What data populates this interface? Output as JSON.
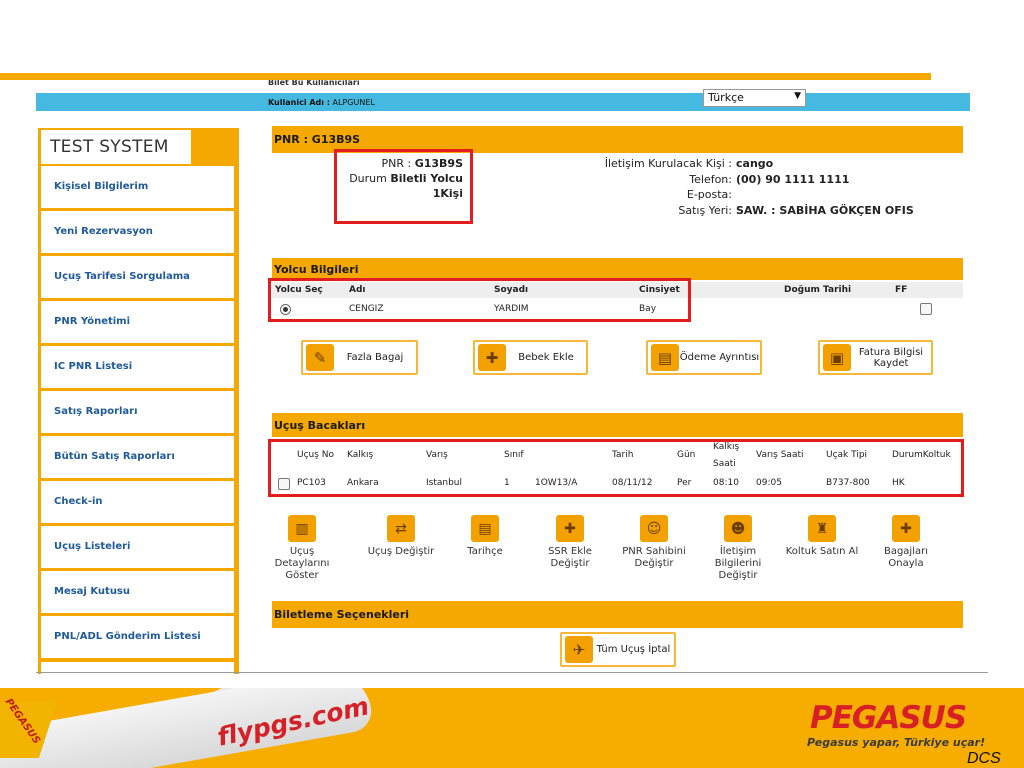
{
  "header": {
    "user_cut": "Bilet Bu Kullanıcıları",
    "user_label": "Kullanici Adı :",
    "user_name": "ALPGUNEL",
    "language": "Türkçe"
  },
  "sidebar": {
    "title": "TEST SYSTEM",
    "items": [
      {
        "label": "Kişisel Bilgilerim"
      },
      {
        "label": "Yeni Rezervasyon"
      },
      {
        "label": "Uçuş Tarifesi Sorgulama"
      },
      {
        "label": "PNR Yönetimi"
      },
      {
        "label": "IC PNR Listesi"
      },
      {
        "label": "Satış Raporları"
      },
      {
        "label": "Bütün Satış Raporları"
      },
      {
        "label": "Check-in"
      },
      {
        "label": "Uçuş Listeleri"
      },
      {
        "label": "Mesaj Kutusu"
      },
      {
        "label": "PNL/ADL Gönderim Listesi"
      }
    ]
  },
  "pnr": {
    "header": "PNR : G13B9S",
    "pnr_label": "PNR :",
    "pnr_value": "G13B9S",
    "status_label": "Durum",
    "status_value": "Biletli Yolcu",
    "pax_count": "1Kişi",
    "contact_label": "İletişim Kurulacak Kişi :",
    "contact_value": "cango",
    "phone_label": "Telefon:",
    "phone_value": "(00) 90 1111 1111",
    "email_label": "E-posta:",
    "email_value": "",
    "sales_label": "Satış Yeri:",
    "sales_value": "SAW. : SABİHA GÖKÇEN OFIS"
  },
  "passengers": {
    "header": "Yolcu Bilgileri",
    "columns": {
      "select": "Yolcu Seç",
      "name": "Adı",
      "surname": "Soyadı",
      "gender": "Cinsiyet",
      "dob": "Doğum Tarihi",
      "ff": "FF"
    },
    "rows": [
      {
        "name": "CENGIZ",
        "surname": "YARDIM",
        "gender": "Bay",
        "dob": ""
      }
    ]
  },
  "actions": {
    "excess_baggage": "Fazla Bagaj",
    "add_infant": "Bebek Ekle",
    "payment_details": "Ödeme Ayrıntısı",
    "save_invoice": "Fatura Bilgisi Kaydet"
  },
  "flights": {
    "header": "Uçuş Bacakları",
    "columns": {
      "flight_no": "Uçuş No",
      "departure": "Kalkış",
      "arrival": "Varış",
      "class": "Sınıf",
      "date": "Tarih",
      "day": "Gün",
      "dep_time_1": "Kalkış",
      "dep_time_2": "Saati",
      "arr_time": "Varış Saati",
      "aircraft": "Uçak Tipi",
      "status_seat": "DurumKoltuk"
    },
    "rows": [
      {
        "flight_no": "PC103",
        "departure": "Ankara",
        "arrival": "Istanbul",
        "class": "1",
        "fare": "1OW13/A",
        "date": "08/11/12",
        "day": "Per",
        "dep_time": "08:10",
        "arr_time": "09:05",
        "aircraft": "B737-800",
        "status": "HK"
      }
    ]
  },
  "tools": [
    {
      "label": "Uçuş Detaylarını Göster"
    },
    {
      "label": "Uçuş Değiştir"
    },
    {
      "label": "Tarihçe"
    },
    {
      "label": "SSR Ekle Değiştir"
    },
    {
      "label": "PNR Sahibini Değiştir"
    },
    {
      "label": "İletişim Bilgilerini Değiştir"
    },
    {
      "label": "Koltuk Satın Al"
    },
    {
      "label": "Bagajları Onayla"
    }
  ],
  "ticketing": {
    "header": "Biletleme Seçenekleri",
    "cancel_all": "Tüm Uçuş İptal"
  },
  "footer": {
    "plane_text": "flypgs.com",
    "tail_text": "PEGASUS",
    "logo": "PEGASUS",
    "slogan": "Pegasus yapar, Türkiye uçar!",
    "slide_tag": "DCS"
  },
  "colors": {
    "accent": "#f5a800",
    "bar": "#45b9e0",
    "highlight": "#e31d1d",
    "link": "#1f5a9a"
  }
}
